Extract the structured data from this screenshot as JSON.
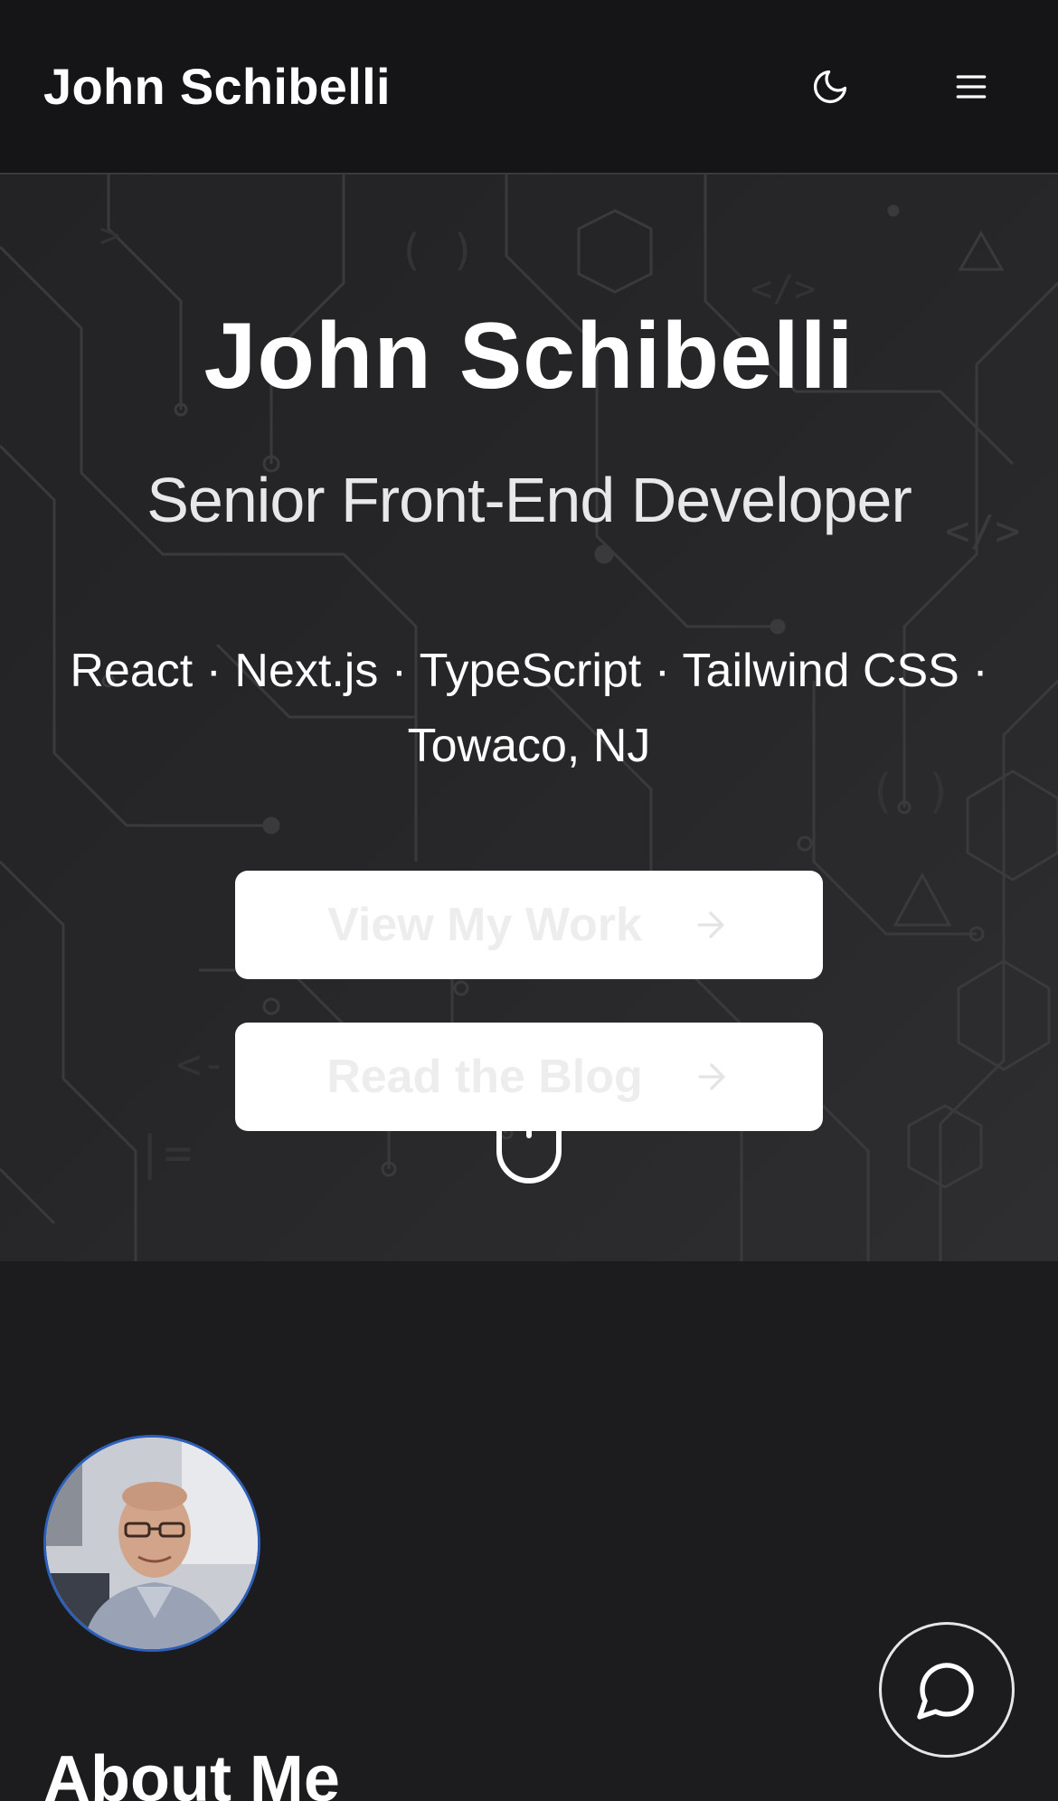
{
  "header": {
    "brand": "John Schibelli",
    "theme_icon": "moon-icon",
    "menu_icon": "hamburger-menu-icon"
  },
  "hero": {
    "name": "John Schibelli",
    "title": "Senior Front-End Developer",
    "tags_line1": "React · Next.js · TypeScript · Tailwind CSS ·",
    "tags_line2": "Towaco, NJ",
    "primary_button": "View My Work",
    "secondary_button": "Read the Blog",
    "button_icon": "arrow-right-icon",
    "scroll_icon": "mouse-scroll-icon"
  },
  "about": {
    "heading": "About Me",
    "avatar": "profile-photo"
  },
  "chat": {
    "icon": "chat-bubble-icon"
  },
  "colors": {
    "header_bg": "#151517",
    "page_bg": "#1c1c1f",
    "hero_bg": "#262628",
    "avatar_ring": "#2d5fb8",
    "button_bg": "#ffffff"
  }
}
